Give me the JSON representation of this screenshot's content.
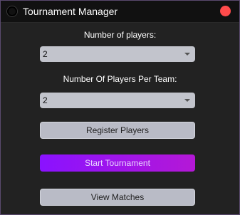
{
  "window": {
    "title": "Tournament Manager"
  },
  "form": {
    "players_label": "Number of players:",
    "players_value": "2",
    "per_team_label": "Number Of Players Per Team:",
    "per_team_value": "2"
  },
  "buttons": {
    "register": "Register Players",
    "start": "Start Tournament",
    "view": "View Matches"
  },
  "colors": {
    "accent_start": "#8a12ff",
    "accent_end": "#b418d6",
    "close": "#ff4b4b"
  }
}
